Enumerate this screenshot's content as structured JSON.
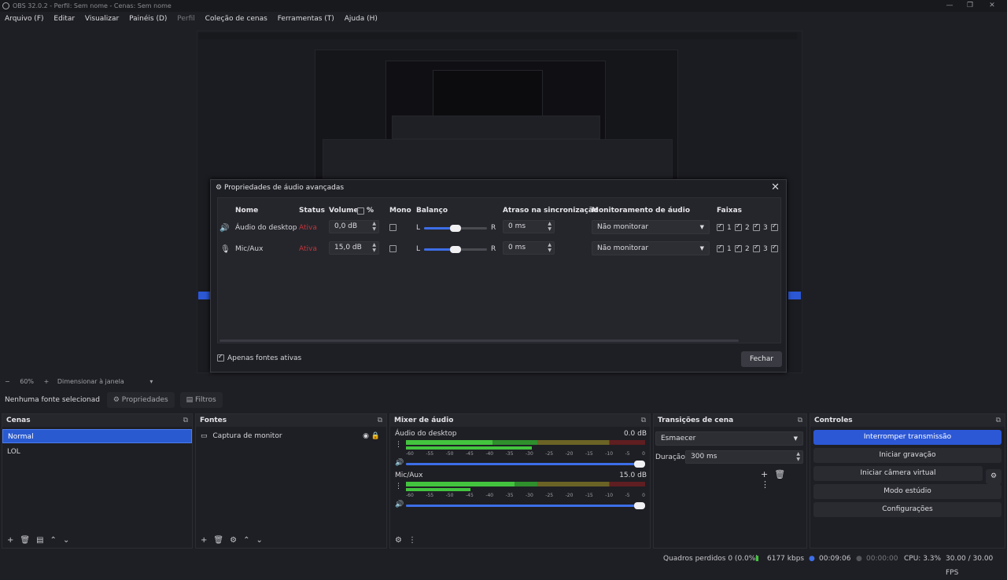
{
  "window": {
    "title": "OBS 32.0.2 - Perfil: Sem nome - Cenas: Sem nome"
  },
  "menu": [
    "Arquivo (F)",
    "Editar",
    "Visualizar",
    "Painéis (D)",
    "Perfil",
    "Coleção de cenas",
    "Ferramentas (T)",
    "Ajuda (H)"
  ],
  "zoom": {
    "percent": "60%",
    "mode": "Dimensionar à janela"
  },
  "source_bar": {
    "none_selected": "Nenhuma fonte selecionad",
    "properties": "Propriedades",
    "filters": "Filtros"
  },
  "scenes": {
    "title": "Cenas",
    "items": [
      "Normal",
      "LOL"
    ],
    "selected": 0
  },
  "sources": {
    "title": "Fontes",
    "items": [
      {
        "name": "Captura de monitor"
      }
    ]
  },
  "mixer": {
    "title": "Mixer de áudio",
    "channels": [
      {
        "name": "Áudio do desktop",
        "db": "0.0 dB",
        "level": 0.4
      },
      {
        "name": "Mic/Aux",
        "db": "15.0 dB",
        "level": 0.45
      }
    ],
    "scale": [
      "-60",
      "-55",
      "-50",
      "-45",
      "-40",
      "-35",
      "-30",
      "-25",
      "-20",
      "-15",
      "-10",
      "-5",
      "0"
    ]
  },
  "transitions": {
    "title": "Transições de cena",
    "type": "Esmaecer",
    "duration_label": "Duração",
    "duration": "300 ms"
  },
  "controls": {
    "title": "Controles",
    "buttons": [
      "Interromper transmissão",
      "Iniciar gravação",
      "Iniciar câmera virtual",
      "Modo estúdio",
      "Configurações"
    ]
  },
  "status": {
    "frames": "Quadros perdidos 0 (0.0%)",
    "bitrate": "6177 kbps",
    "stream_time": "00:09:06",
    "rec_time": "00:00:00",
    "cpu": "CPU: 3.3%",
    "fps": "30.00 / 30.00 FPS"
  },
  "dialog": {
    "title": "Propriedades de áudio avançadas",
    "headers": {
      "name": "Nome",
      "status": "Status",
      "volume": "Volume",
      "percent": "%",
      "mono": "Mono",
      "balance": "Balanço",
      "sync": "Atraso na sincronização",
      "monitoring": "Monitoramento de áudio",
      "tracks": "Faixas"
    },
    "rows": [
      {
        "name": "Áudio do desktop",
        "status": "Ativa",
        "volume": "0,0 dB",
        "sync": "0 ms",
        "monitoring": "Não monitorar",
        "balance": 0.5
      },
      {
        "name": "Mic/Aux",
        "status": "Ativa",
        "volume": "15,0 dB",
        "sync": "0 ms",
        "monitoring": "Não monitorar",
        "balance": 0.5
      }
    ],
    "balance_left": "L",
    "balance_right": "R",
    "track_labels": [
      "1",
      "2",
      "3"
    ],
    "only_active": "Apenas fontes ativas",
    "close": "Fechar"
  },
  "colors": {
    "accent": "#2c58d6",
    "meter_green": "#43c43f",
    "meter_yellow": "#c4a634",
    "meter_red": "#b8383b",
    "status_red": "#c0353b"
  }
}
